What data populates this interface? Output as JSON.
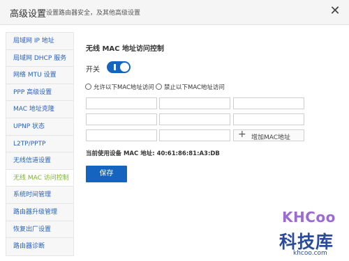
{
  "header": {
    "title": "高级设置",
    "subtitle": "设置路由器安全，及其他高级设置",
    "close_symbol": "✕"
  },
  "sidebar": {
    "items": [
      {
        "label": "局域网 IP 地址",
        "active": false
      },
      {
        "label": "局域网 DHCP 服务",
        "active": false
      },
      {
        "label": "网络 MTU 设置",
        "active": false
      },
      {
        "label": "PPP 高级设置",
        "active": false
      },
      {
        "label": "MAC 地址克隆",
        "active": false
      },
      {
        "label": "UPNP 状态",
        "active": false
      },
      {
        "label": "L2TP/PPTP",
        "active": false
      },
      {
        "label": "无线信道设置",
        "active": false
      },
      {
        "label": "无线 MAC 访问控制",
        "active": true
      },
      {
        "label": "系统时间管理",
        "active": false
      },
      {
        "label": "路由器升级管理",
        "active": false
      },
      {
        "label": "恢复出厂设置",
        "active": false
      },
      {
        "label": "路由器诊断",
        "active": false
      }
    ]
  },
  "main": {
    "section_title": "无线 MAC 地址访问控制",
    "switch_label": "开关",
    "switch_on": true,
    "radio_allow": "允许以下MAC地址访问",
    "radio_deny": "禁止以下MAC地址访问",
    "mac_inputs": [
      "",
      "",
      "",
      "",
      "",
      "",
      "",
      ""
    ],
    "add_button": "增加MAC地址",
    "current_mac_label": "当前使用设备 MAC 地址:",
    "current_mac_value": "40:61:86:81:A3:DB",
    "save_button": "保存"
  },
  "watermark": {
    "brand": "KHCoo",
    "chinese": "科技库",
    "url": "khcoo.com"
  },
  "colors": {
    "accent": "#1565c0",
    "active_menu": "#7fb030",
    "menu_link": "#2a62b8"
  }
}
